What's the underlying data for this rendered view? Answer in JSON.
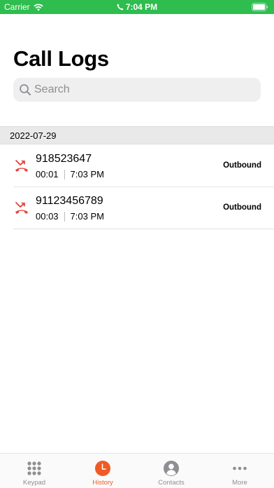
{
  "status_bar": {
    "carrier": "Carrier",
    "time": "7:04 PM",
    "background": "#2ebd4e"
  },
  "header": {
    "title": "Call Logs"
  },
  "search": {
    "placeholder": "Search",
    "value": ""
  },
  "sections": [
    {
      "date": "2022-07-29",
      "calls": [
        {
          "number": "918523647",
          "duration": "00:01",
          "time": "7:03 PM",
          "direction": "Outbound",
          "icon": "missed-outbound-call-icon"
        },
        {
          "number": "91123456789",
          "duration": "00:03",
          "time": "7:03 PM",
          "direction": "Outbound",
          "icon": "missed-outbound-call-icon"
        }
      ]
    }
  ],
  "tab_bar": {
    "tabs": [
      {
        "label": "Keypad",
        "icon": "keypad-icon",
        "active": false
      },
      {
        "label": "History",
        "icon": "clock-icon",
        "active": true
      },
      {
        "label": "Contacts",
        "icon": "person-icon",
        "active": false
      },
      {
        "label": "More",
        "icon": "ellipsis-icon",
        "active": false
      }
    ]
  },
  "colors": {
    "accent": "#f05a24",
    "call_icon": "#e5443a",
    "inactive": "#8e8e93"
  }
}
